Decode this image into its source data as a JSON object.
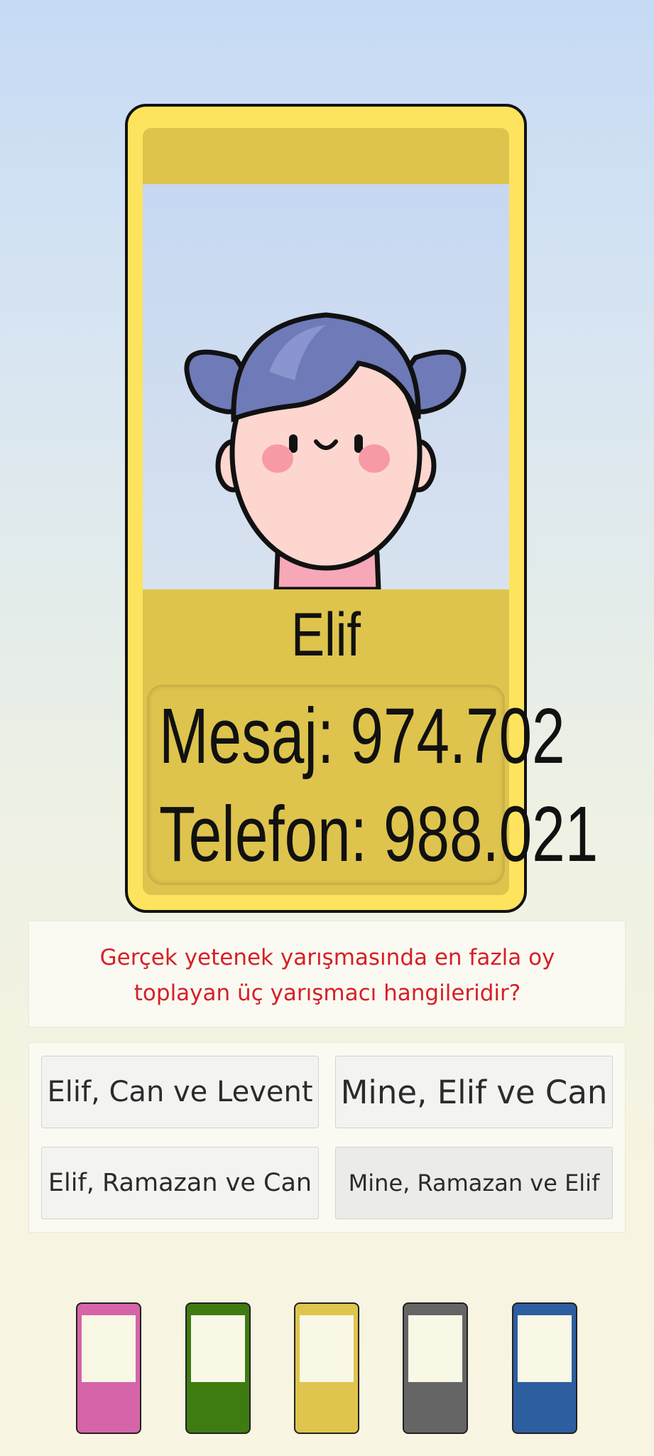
{
  "card": {
    "name": "Elif",
    "stats": {
      "message": "Mesaj: 974.702",
      "phone": "Telefon: 988.021"
    },
    "avatar_icon": "girl-with-pigtails-avatar"
  },
  "question": {
    "line1": "Gerçek yetenek yarışmasında en fazla oy",
    "line2": "toplayan üç yarışmacı hangileridir?"
  },
  "answers": [
    {
      "label": "Elif, Can ve Levent"
    },
    {
      "label": "Mine, Elif ve Can"
    },
    {
      "label": "Elif, Ramazan ve Can"
    },
    {
      "label": "Mine, Ramazan ve Elif"
    }
  ],
  "colors": {
    "card": "#fee35e",
    "card_band": "#dec44d",
    "question_text": "#d61f26",
    "buttons": [
      "#d565a8",
      "#3e7b11",
      "#dfc54e",
      "#656565",
      "#2d5ea0"
    ]
  }
}
